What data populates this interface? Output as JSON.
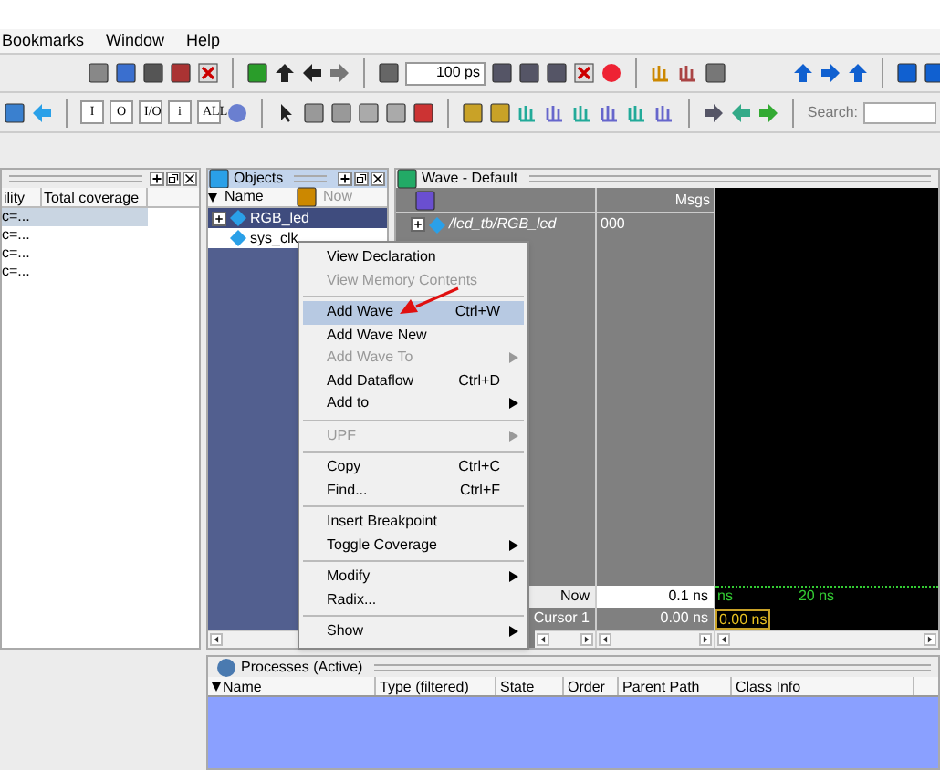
{
  "menu_bar": [
    "Bookmarks",
    "Window",
    "Help"
  ],
  "toolbar": {
    "time_field": "100 ps",
    "filter_buttons": [
      "I",
      "O",
      "I/O",
      "i",
      "ALL"
    ],
    "search_label": "Search:"
  },
  "coverage_panel": {
    "columns": [
      "ility",
      "Total coverage"
    ],
    "rows": [
      {
        "text": "c=...",
        "selected": true
      },
      {
        "text": "c=...",
        "selected": false
      },
      {
        "text": "c=...",
        "selected": false
      },
      {
        "text": "c=...",
        "selected": false
      }
    ]
  },
  "objects": {
    "title": "Objects",
    "columns": [
      "Name",
      "Now"
    ],
    "items": [
      {
        "name": "RGB_led",
        "expandable": true,
        "selected": true
      },
      {
        "name": "sys_clk",
        "expandable": false,
        "selected": false
      }
    ]
  },
  "wave": {
    "title": "Wave - Default",
    "msgs_label": "Msgs",
    "signals": [
      {
        "name": "/led_tb/RGB_led",
        "value": "000"
      }
    ],
    "now_label": "Now",
    "now_value": "0.1 ns",
    "cursor_label": "Cursor 1",
    "cursor_value": "0.00 ns",
    "time_ticks": [
      "ns",
      "20 ns"
    ],
    "cursor_time": "0.00 ns"
  },
  "context_menu": [
    {
      "kind": "item",
      "label": "View Declaration",
      "submenu": false,
      "disabled": false,
      "selected": false
    },
    {
      "kind": "item",
      "label": "View Memory Contents",
      "submenu": false,
      "disabled": true,
      "selected": false
    },
    {
      "kind": "separator"
    },
    {
      "kind": "item",
      "label": "Add Wave",
      "shortcut": "Ctrl+W",
      "submenu": false,
      "disabled": false,
      "selected": true
    },
    {
      "kind": "item",
      "label": "Add Wave New",
      "submenu": false,
      "disabled": false,
      "selected": false
    },
    {
      "kind": "item",
      "label": "Add Wave To",
      "submenu": true,
      "disabled": true,
      "selected": false
    },
    {
      "kind": "item",
      "label": "Add Dataflow",
      "shortcut": "Ctrl+D",
      "submenu": false,
      "disabled": false,
      "selected": false
    },
    {
      "kind": "item",
      "label": "Add to",
      "submenu": true,
      "disabled": false,
      "selected": false
    },
    {
      "kind": "separator"
    },
    {
      "kind": "item",
      "label": "UPF",
      "submenu": true,
      "disabled": true,
      "selected": false
    },
    {
      "kind": "separator"
    },
    {
      "kind": "item",
      "label": "Copy",
      "shortcut": "Ctrl+C",
      "submenu": false,
      "disabled": false,
      "selected": false
    },
    {
      "kind": "item",
      "label": "Find...",
      "shortcut": "Ctrl+F",
      "submenu": false,
      "disabled": false,
      "selected": false
    },
    {
      "kind": "separator"
    },
    {
      "kind": "item",
      "label": "Insert Breakpoint",
      "submenu": false,
      "disabled": false,
      "selected": false
    },
    {
      "kind": "item",
      "label": "Toggle Coverage",
      "submenu": true,
      "disabled": false,
      "selected": false
    },
    {
      "kind": "separator"
    },
    {
      "kind": "item",
      "label": "Modify",
      "submenu": true,
      "disabled": false,
      "selected": false
    },
    {
      "kind": "item",
      "label": "Radix...",
      "submenu": false,
      "disabled": false,
      "selected": false
    },
    {
      "kind": "separator"
    },
    {
      "kind": "item",
      "label": "Show",
      "submenu": true,
      "disabled": false,
      "selected": false
    }
  ],
  "processes": {
    "title": "Processes (Active)",
    "columns": [
      "Name",
      "Type (filtered)",
      "State",
      "Order",
      "Parent Path",
      "Class Info"
    ]
  }
}
